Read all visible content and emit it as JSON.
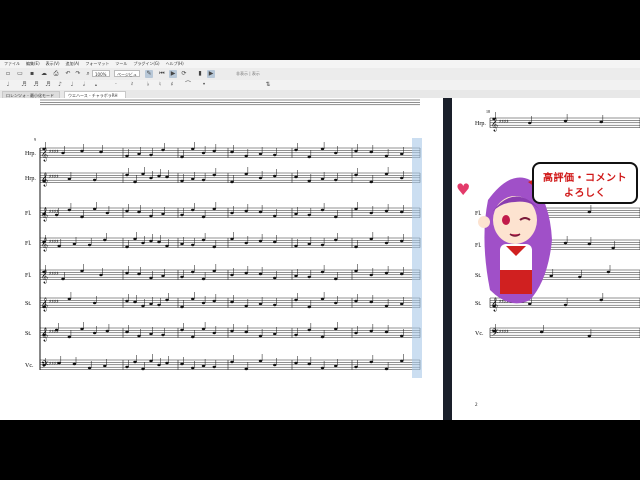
{
  "menu": [
    "ファイル",
    "編集(E)",
    "表示(V)",
    "追加(A)",
    "フォーマット",
    "ツール",
    "プラグイン(G)",
    "ヘルプ(H)"
  ],
  "toolbar": {
    "zoom": "100%",
    "view": "ページビュー",
    "right_label": "非表示 | 表示"
  },
  "tabs": [
    {
      "label": "ロレンツォ - 最小化モード",
      "active": false
    },
    {
      "label": "ウエハース - チャラボラRH",
      "active": true
    }
  ],
  "score": {
    "page1": {
      "measure_number": "9",
      "instruments": [
        "Hrp.",
        "Hrp.",
        "Fl.",
        "Fl.",
        "Fl.",
        "St.",
        "St.",
        "Vc."
      ]
    },
    "page2": {
      "measure_number": "18",
      "instruments": [
        "Hrp.",
        "Fl.",
        "Fl.",
        "St.",
        "St.",
        "Vc."
      ],
      "page_number": "2"
    }
  },
  "overlay": {
    "bubble_line1": "高評価・コメント",
    "bubble_line2": "よろしく",
    "heart_icon": "heart-icon",
    "colors": {
      "text": "#d01818",
      "hair": "#a050c8",
      "ribbon": "#d02020"
    }
  }
}
